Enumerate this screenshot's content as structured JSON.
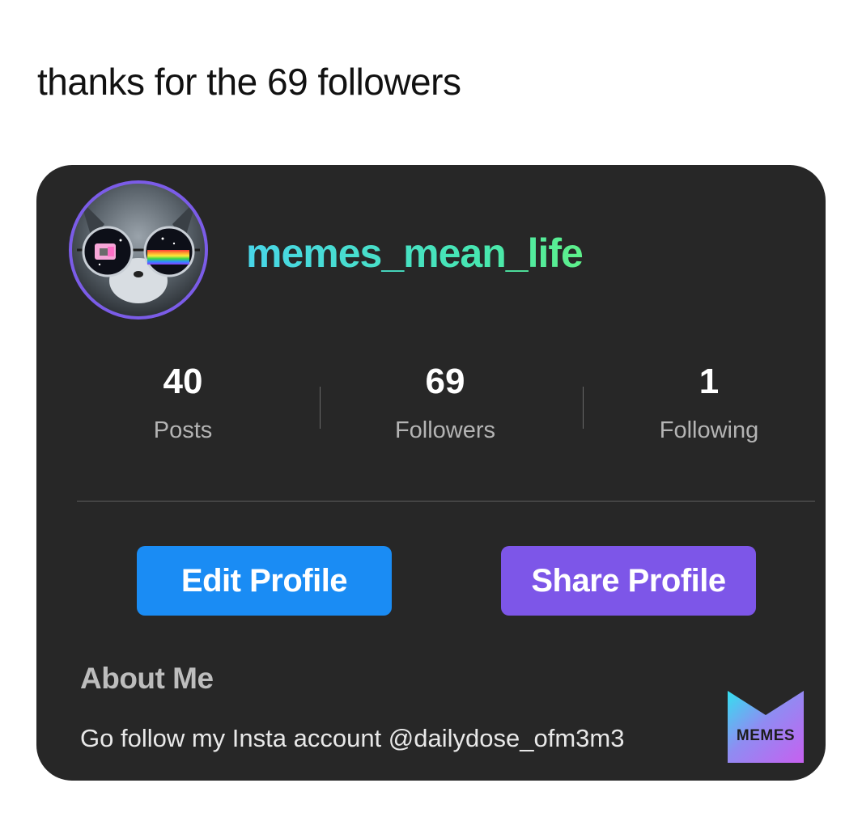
{
  "caption": "thanks for the 69 followers",
  "profile": {
    "username": "memes_mean_life",
    "avatar_icon": "cat-with-sunglasses-avatar"
  },
  "stats": [
    {
      "value": "40",
      "label": "Posts"
    },
    {
      "value": "69",
      "label": "Followers"
    },
    {
      "value": "1",
      "label": "Following"
    }
  ],
  "buttons": {
    "edit": "Edit Profile",
    "share": "Share Profile"
  },
  "about": {
    "heading": "About Me",
    "text": "Go follow my Insta account @dailydose_ofm3m3"
  },
  "watermark": {
    "label": "MEMES"
  },
  "colors": {
    "card_bg": "#272727",
    "edit_button": "#1a8cf4",
    "share_button": "#7d56e8",
    "username_gradient_start": "#48d6e8",
    "username_gradient_end": "#5ef08a",
    "avatar_ring": "#7b5ce8"
  }
}
